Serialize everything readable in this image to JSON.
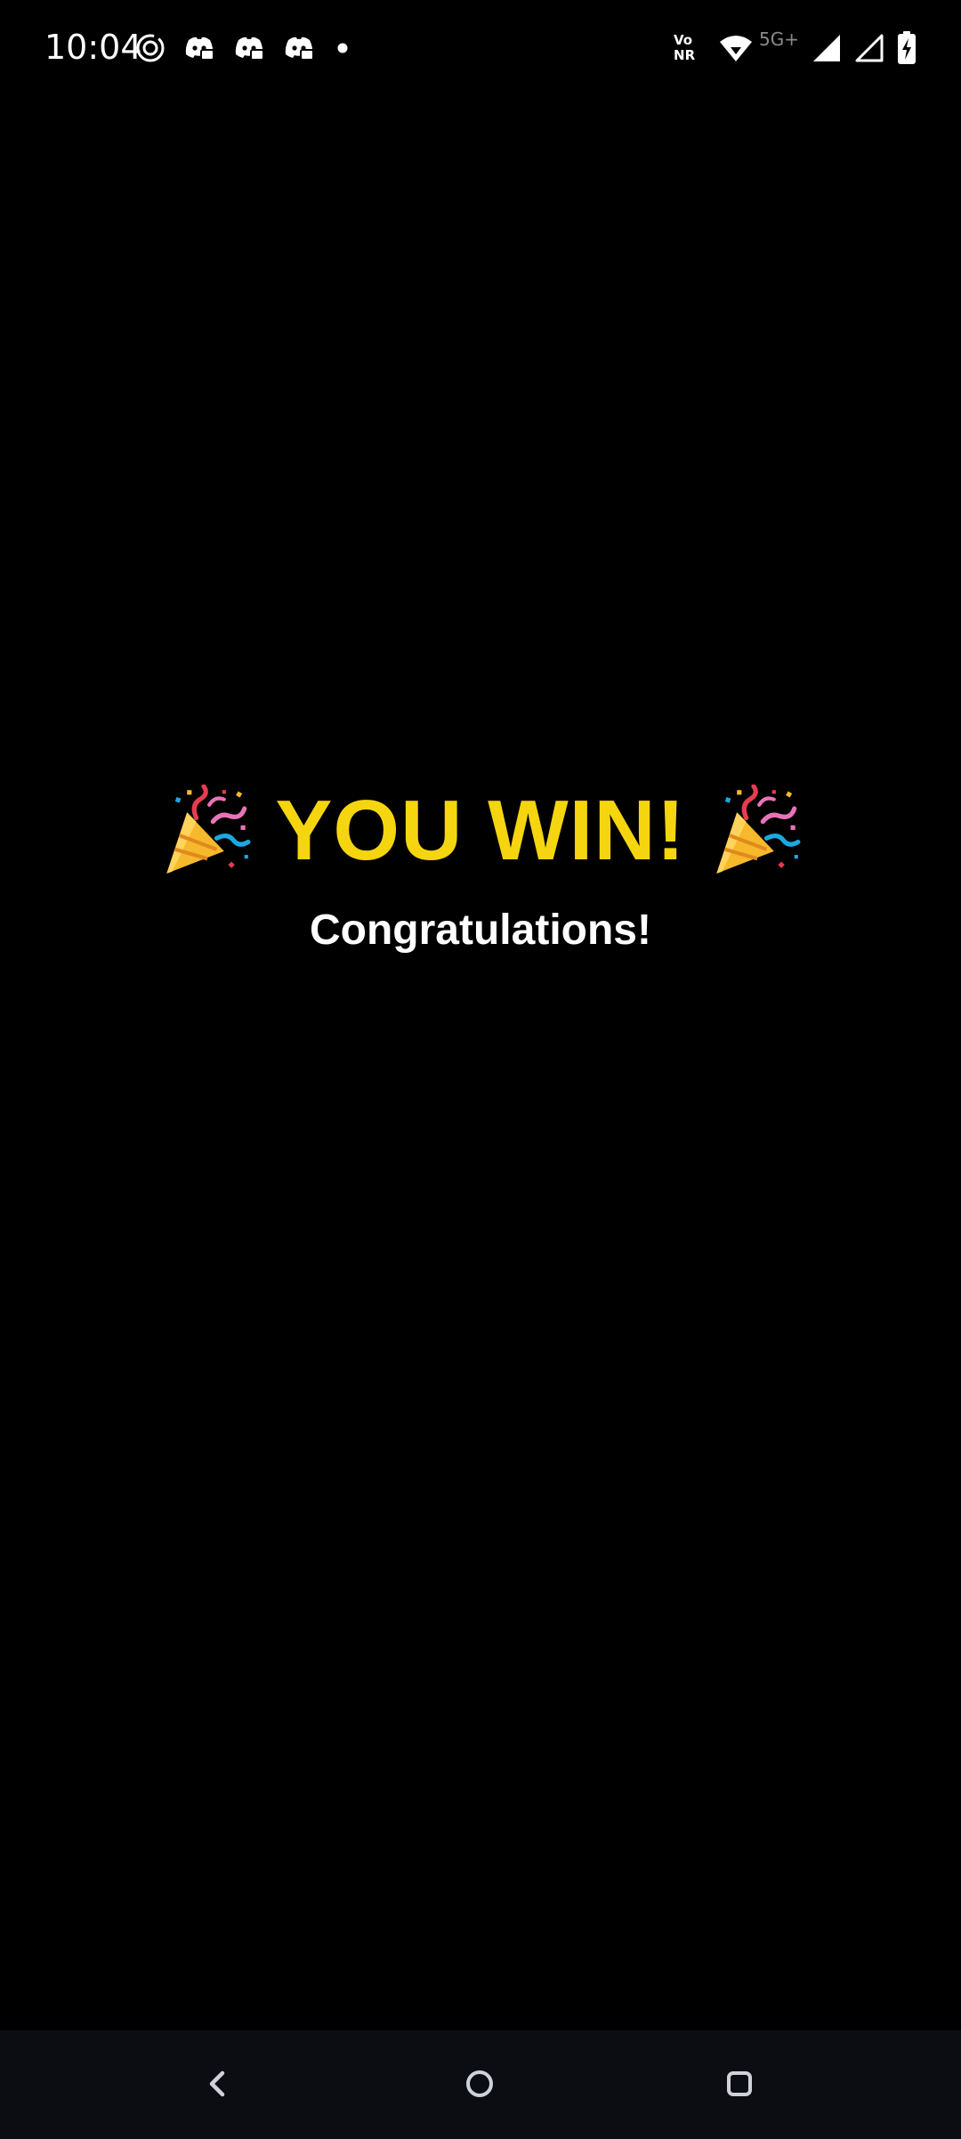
{
  "status_bar": {
    "time": "10:04",
    "left_icons": [
      "focus-mode-icon",
      "discord-icon",
      "discord-icon",
      "discord-icon",
      "notification-dot-icon"
    ],
    "network_badge_line1": "Vo",
    "network_badge_line2": "NR",
    "network_label": "5G+",
    "right_icons": [
      "volte-nr-icon",
      "wifi-icon",
      "cell-signal-full-icon",
      "cell-signal-empty-icon",
      "battery-charging-icon"
    ]
  },
  "game_over": {
    "title": "YOU WIN!",
    "subtitle": "Congratulations!",
    "decoration_icon": "party-popper-icon",
    "title_color": "#f5d50f",
    "subtitle_color": "#ffffff"
  },
  "navigation_bar": {
    "buttons": [
      "back-icon",
      "home-icon",
      "recents-icon"
    ],
    "background": "#0b0d13"
  },
  "colors": {
    "background": "#000000"
  }
}
